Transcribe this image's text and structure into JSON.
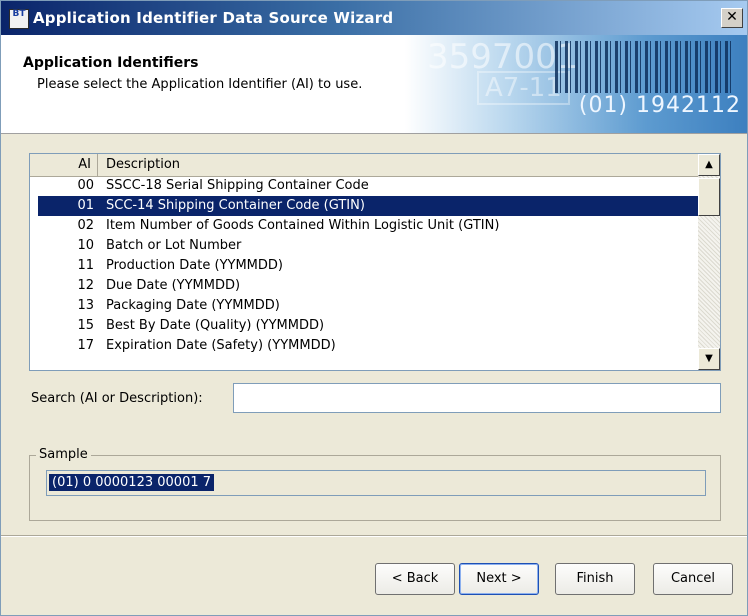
{
  "window": {
    "title": "Application Identifier Data Source Wizard",
    "icon_text": "BT",
    "close_label": "✕"
  },
  "header": {
    "title": "Application Identifiers",
    "subtitle": "Please select the Application Identifier (AI) to use.",
    "banner_ghost_1": "3597001",
    "banner_ghost_2": "A7-11",
    "banner_code": "(01) 1942112"
  },
  "list": {
    "col_ai": "AI",
    "col_description": "Description",
    "rows": [
      {
        "ai": "00",
        "description": "SSCC-18 Serial Shipping Container Code"
      },
      {
        "ai": "01",
        "description": "SCC-14 Shipping Container Code (GTIN)"
      },
      {
        "ai": "02",
        "description": "Item Number of Goods Contained Within Logistic Unit (GTIN)"
      },
      {
        "ai": "10",
        "description": "Batch or Lot Number"
      },
      {
        "ai": "11",
        "description": "Production Date (YYMMDD)"
      },
      {
        "ai": "12",
        "description": "Due Date (YYMMDD)"
      },
      {
        "ai": "13",
        "description": "Packaging Date (YYMMDD)"
      },
      {
        "ai": "15",
        "description": "Best By Date (Quality) (YYMMDD)"
      },
      {
        "ai": "17",
        "description": "Expiration Date (Safety) (YYMMDD)"
      }
    ],
    "scroll_up": "▲",
    "scroll_down": "▼"
  },
  "search": {
    "label": "Search (AI or Description):",
    "value": ""
  },
  "sample": {
    "legend": "Sample",
    "value": "(01) 0 0000123 00001 7"
  },
  "buttons": {
    "back": "< Back",
    "next": "Next >",
    "finish": "Finish",
    "cancel": "Cancel"
  }
}
